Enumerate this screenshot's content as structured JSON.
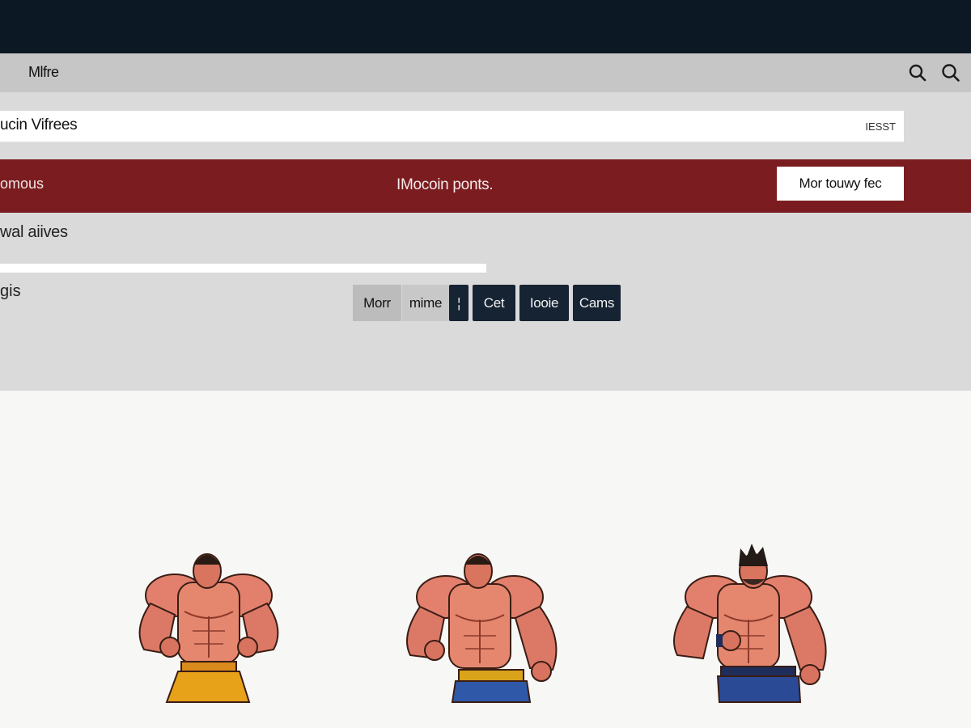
{
  "header": {
    "title": "Mlfre",
    "icons": [
      "search-icon",
      "search-icon"
    ]
  },
  "search": {
    "label": "ucin Vifrees",
    "tag": "IESST"
  },
  "banner": {
    "left_text": "omous",
    "center_text": "IMocoin ponts.",
    "button_label": "Mor touwy fec"
  },
  "subtitle": "wal aiives",
  "row_label": "gis",
  "toolbar": {
    "buttons": [
      "Morr",
      "mime",
      "¦",
      "Cet",
      "Iooie",
      "Cams"
    ]
  },
  "figures": [
    {
      "name": "character-1",
      "belt_color": "#d98a1c",
      "pants_color": "#e8a21a"
    },
    {
      "name": "character-2",
      "belt_color": "#d9a31c",
      "pants_color": "#2f58a8"
    },
    {
      "name": "character-3",
      "belt_color": "#1f2d5a",
      "pants_color": "#2b4a96"
    }
  ],
  "colors": {
    "topbar": "#0c1823",
    "banner": "#7b1d20",
    "dark_button": "#162333"
  }
}
